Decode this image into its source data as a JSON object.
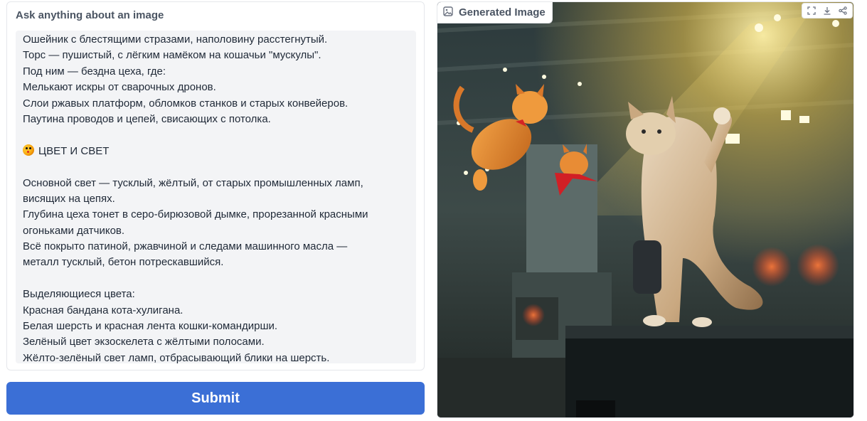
{
  "left": {
    "label": "Ask anything about an image",
    "lines": [
      "Ошейник с блестящими стразами, наполовину расстегнутый.",
      "Торс — пушистый, с лёгким намёком на кошачьи \"мускулы\".",
      "Под ним — бездна цеха, где:",
      "Мелькают искры от сварочных дронов.",
      "Слои ржавых платформ, обломков станков и старых конвейеров.",
      "Паутина проводов и цепей, свисающих с потолка.",
      "",
      "ЦВЕТ И СВЕТ",
      "",
      "Основной свет — тусклый, жёлтый, от старых промышленных ламп,",
      "висящих на цепях.",
      "Глубина цеха тонет в серо-бирюзовой дымке, прорезанной красными",
      "огоньками датчиков.",
      "Всё покрыто патиной, ржавчиной и следами машинного масла —",
      "металл тусклый, бетон потрескавшийся.",
      "",
      "Выделяющиеся цвета:",
      "Красная бандана кота-хулигана.",
      "Белая шерсть и красная лента кошки-командирши.",
      "Зелёный цвет экзоскелета с жёлтыми полосами.",
      "Жёлто-зелёный свет ламп, отбрасывающий блики на шерсть."
    ],
    "emoji_icon": "artist-palette-icon"
  },
  "submit": {
    "label": "Submit"
  },
  "right": {
    "label": "Generated Image",
    "label_icon": "image-icon",
    "tools": [
      "fullscreen-icon",
      "download-icon",
      "share-icon"
    ]
  },
  "colors": {
    "accent": "#3b6fd6",
    "text": "#1f2937",
    "muted": "#4b5563",
    "textbox_bg": "#f3f4f6"
  }
}
